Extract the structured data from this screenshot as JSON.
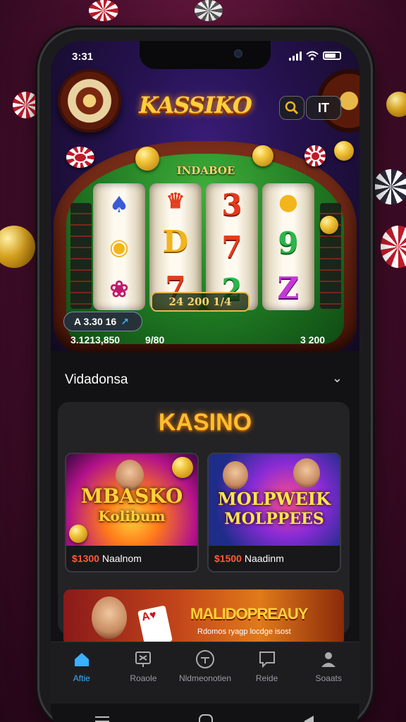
{
  "status_bar": {
    "time": "3:31"
  },
  "header": {
    "logo": "KASSIKO",
    "lang_label": "IT"
  },
  "game": {
    "felt_label": "INDABOE",
    "reel_symbols": [
      [
        "3",
        "D",
        "7"
      ],
      [
        "0",
        "7",
        "2"
      ],
      [
        "9",
        "0",
        "Z"
      ]
    ],
    "bet_box": "24  200  1/4",
    "balance_pill": "A 3.30  16",
    "info_left": "3.1213,850",
    "info_mid": "9/80",
    "info_right": "3  200"
  },
  "section": {
    "title": "Vidadonsa",
    "card_title": "KASINO"
  },
  "games": [
    {
      "name": "MBASKO",
      "sub": "Kolibum",
      "price": "$1300",
      "label": "Naalnom"
    },
    {
      "name": "MOLPWEIK",
      "sub": "MOLPPEES",
      "price": "$1500",
      "label": "Naadinm"
    }
  ],
  "banner": {
    "title": "MALIDOPREAUY",
    "sub": "Rdomos ryagp locdge isost"
  },
  "bottom_nav": [
    {
      "label": "Aftie",
      "icon": "home-icon",
      "active": true
    },
    {
      "label": "Roaole",
      "icon": "slots-icon",
      "active": false
    },
    {
      "label": "Nldmeonotien",
      "icon": "clock-icon",
      "active": false
    },
    {
      "label": "Reide",
      "icon": "chat-icon",
      "active": false
    },
    {
      "label": "Soaats",
      "icon": "user-icon",
      "active": false
    }
  ],
  "colors": {
    "accent": "#3ab0ff",
    "gold": "#ffbe2e",
    "brand": "#7a1f4a"
  }
}
